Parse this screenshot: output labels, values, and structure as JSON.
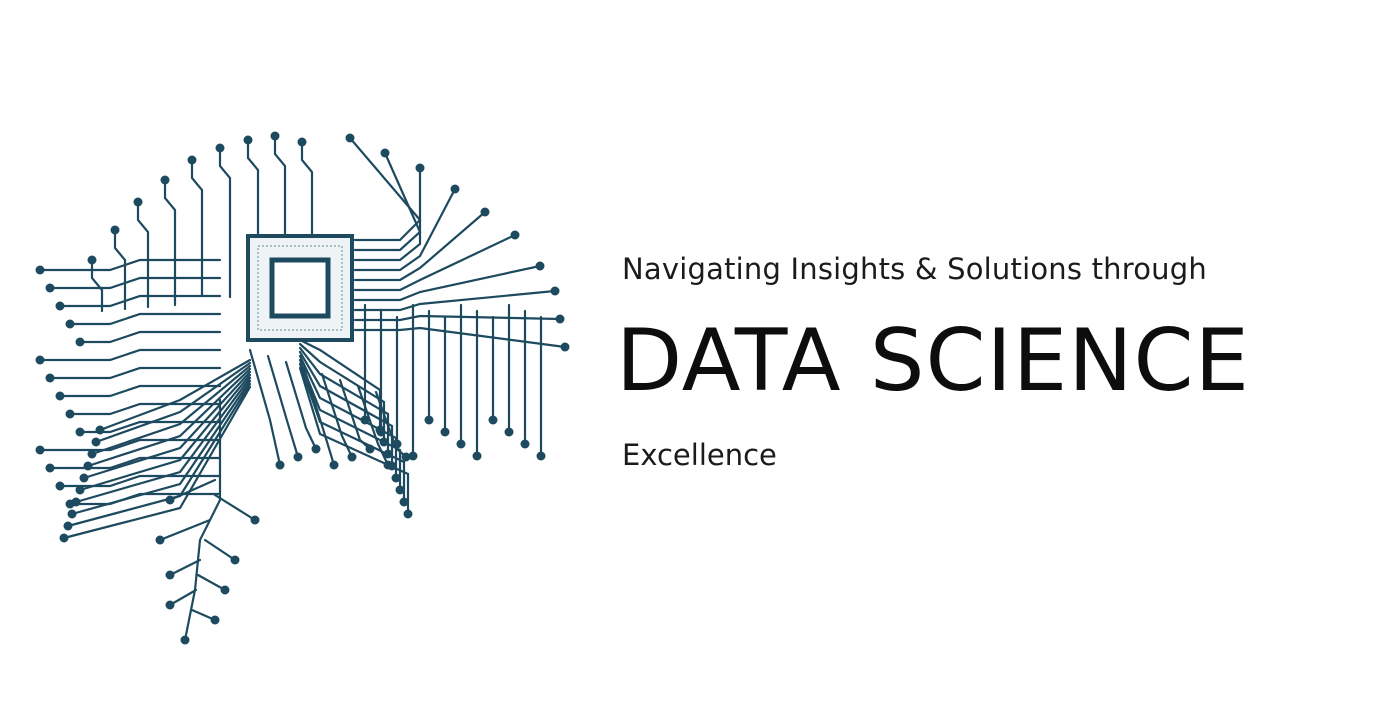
{
  "logo": {
    "icon": "circuit-brain-icon",
    "color": "#1e4a60",
    "chip_color": "#2a5a73"
  },
  "text": {
    "tagline": "Navigating Insights & Solutions through",
    "headline": "DATA SCIENCE",
    "subline": "Excellence"
  }
}
